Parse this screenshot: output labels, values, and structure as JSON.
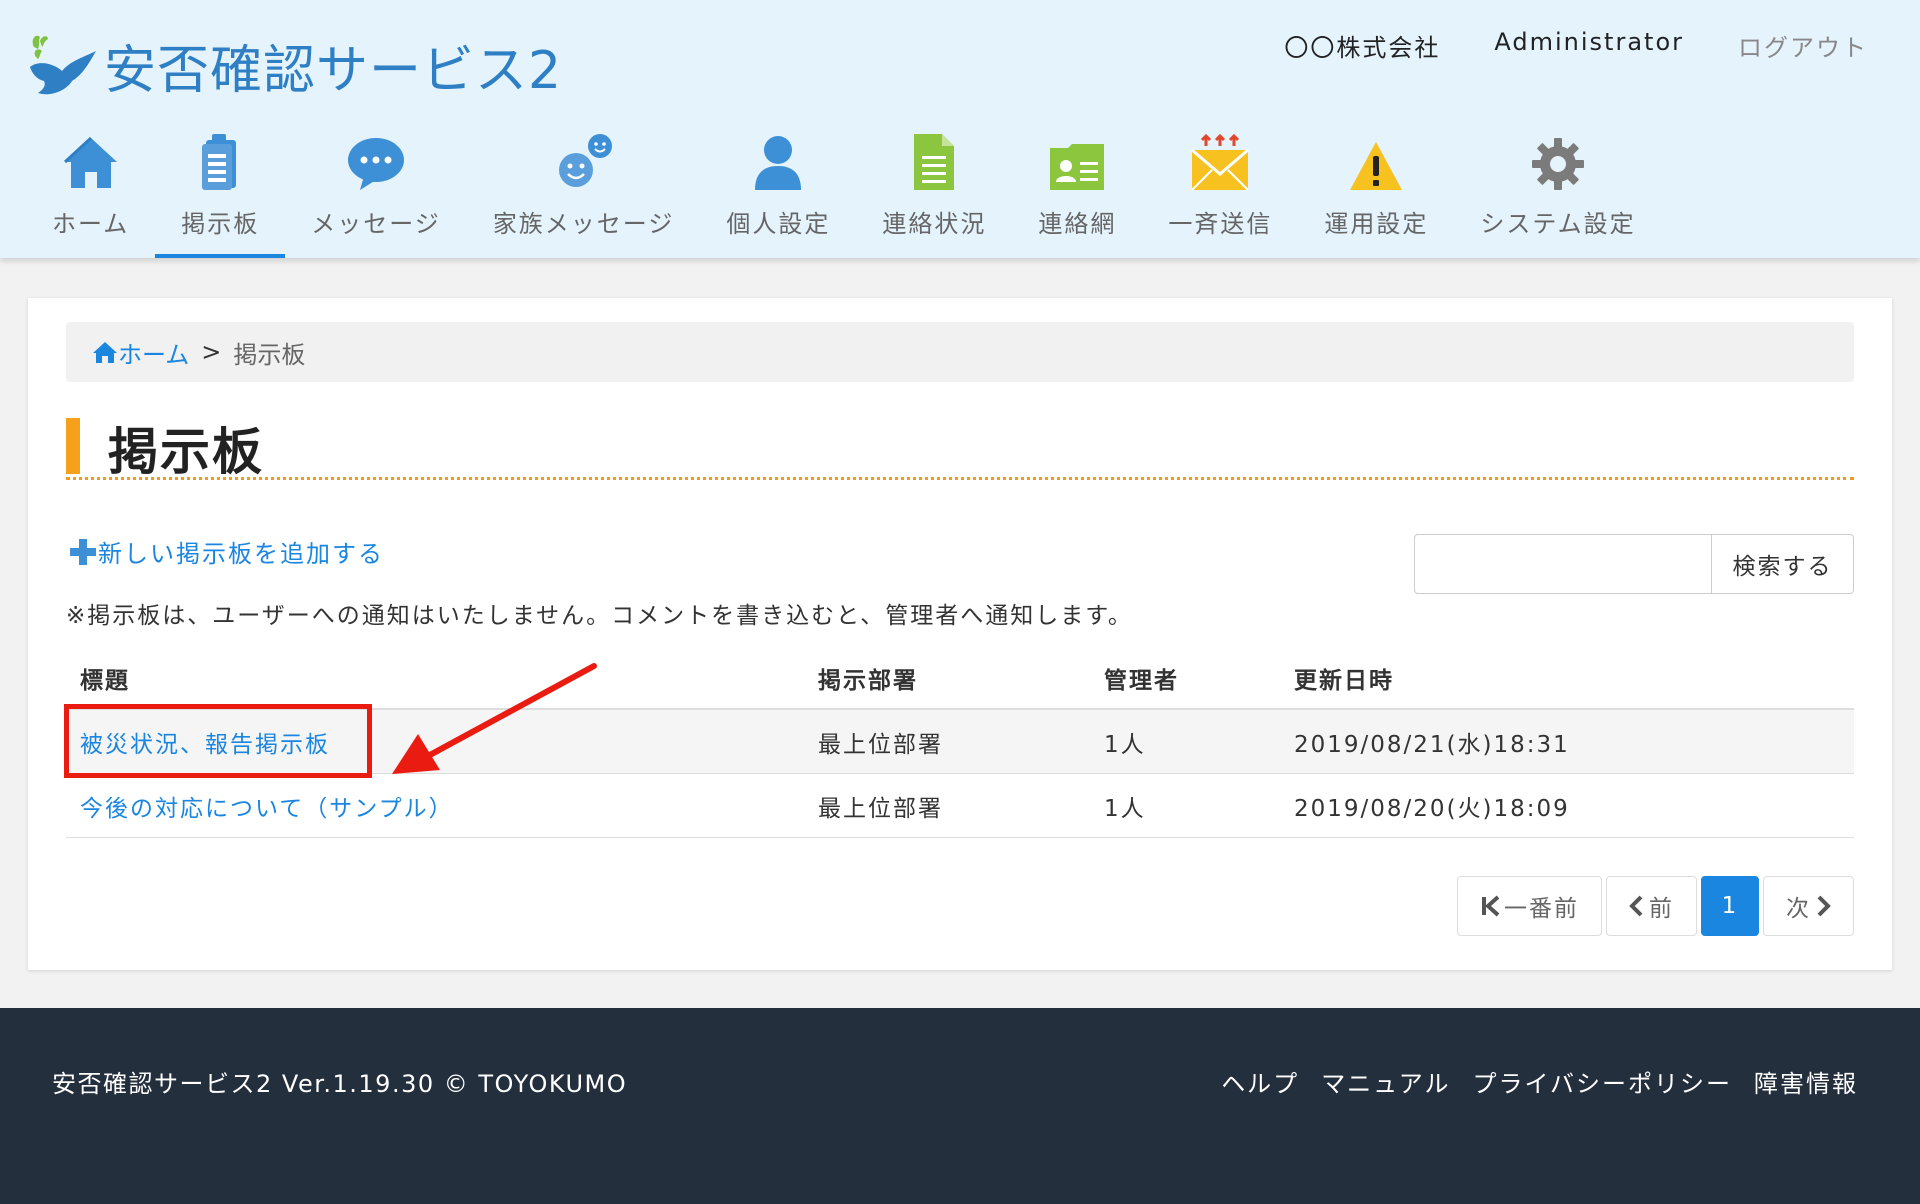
{
  "header": {
    "logo_text": "安否確認サービス2",
    "company": "〇〇株式会社",
    "user": "Administrator",
    "logout": "ログアウト"
  },
  "nav": {
    "items": [
      {
        "label": "ホーム",
        "icon": "home-icon"
      },
      {
        "label": "掲示板",
        "icon": "clipboard-icon",
        "active": true
      },
      {
        "label": "メッセージ",
        "icon": "speech-bubble-icon"
      },
      {
        "label": "家族メッセージ",
        "icon": "family-faces-icon"
      },
      {
        "label": "個人設定",
        "icon": "person-icon"
      },
      {
        "label": "連絡状況",
        "icon": "document-icon"
      },
      {
        "label": "連絡網",
        "icon": "contact-card-folder-icon"
      },
      {
        "label": "一斉送信",
        "icon": "envelope-arrows-icon"
      },
      {
        "label": "運用設定",
        "icon": "warning-icon"
      },
      {
        "label": "システム設定",
        "icon": "gear-icon"
      }
    ]
  },
  "breadcrumb": {
    "home": "ホーム",
    "separator": ">",
    "current": "掲示板"
  },
  "page": {
    "title": "掲示板",
    "add_link": "新しい掲示板を追加する",
    "note": "※掲示板は、ユーザーへの通知はいたしません。コメントを書き込むと、管理者へ通知します。",
    "search_value": "",
    "search_button": "検索する"
  },
  "table": {
    "headers": [
      "標題",
      "掲示部署",
      "管理者",
      "更新日時"
    ],
    "rows": [
      [
        "被災状況、報告掲示板",
        "最上位部署",
        "1人",
        "2019/08/21(水)18:31"
      ],
      [
        "今後の対応について（サンプル）",
        "最上位部署",
        "1人",
        "2019/08/20(火)18:09"
      ]
    ]
  },
  "pagination": {
    "first": "一番前",
    "prev": "前",
    "current": "1",
    "next": "次"
  },
  "footer": {
    "copyright": "安否確認サービス2 Ver.1.19.30 © TOYOKUMO",
    "links": [
      "ヘルプ",
      "マニュアル",
      "プライバシーポリシー",
      "障害情報"
    ]
  },
  "colors": {
    "accent": "#1a86e0",
    "title_bar": "#f5a11c",
    "highlight": "#ea1c12",
    "footer_bg": "#242f3e",
    "header_bg": "#e4f3fc"
  }
}
